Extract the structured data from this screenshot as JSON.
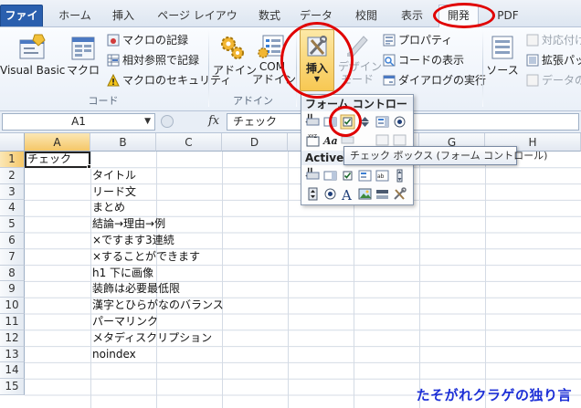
{
  "tabs": [
    {
      "label": "ファイル",
      "style": "file"
    },
    {
      "label": "ホーム"
    },
    {
      "label": "挿入"
    },
    {
      "label": "ページ レイアウト"
    },
    {
      "label": "数式"
    },
    {
      "label": "データ"
    },
    {
      "label": "校閲"
    },
    {
      "label": "表示"
    },
    {
      "label": "開発",
      "active": true
    },
    {
      "label": "PDF"
    }
  ],
  "ribbon": {
    "code": {
      "visual_basic": "Visual Basic",
      "macro": "マクロ",
      "record_macro": "マクロの記録",
      "relative_ref": "相対参照で記録",
      "macro_security": "マクロのセキュリティ",
      "group_label": "コード"
    },
    "addins": {
      "addin": "アドイン",
      "com_line1": "COM",
      "com_line2": "アドイン",
      "group_label": "アドイン"
    },
    "controls": {
      "insert": "挿入",
      "design_line1": "デザイン",
      "design_line2": "モード",
      "properties": "プロパティ",
      "view_code": "コードの表示",
      "run_dialog": "ダイアログの実行"
    },
    "xml": {
      "source": "ソース",
      "map_props": "対応付け",
      "expansion_packs": "拡張パッ",
      "refresh_data": "データの"
    }
  },
  "formula_bar": {
    "name_box": "A1",
    "fx": "fx",
    "content": "チェック"
  },
  "columns": [
    "A",
    "B",
    "C",
    "D",
    "E",
    "F",
    "G",
    "H"
  ],
  "selected_column": "A",
  "rows": [
    {
      "num": "1",
      "a": "チェック",
      "b": ""
    },
    {
      "num": "2",
      "a": "",
      "b": "タイトル"
    },
    {
      "num": "3",
      "a": "",
      "b": "リード文"
    },
    {
      "num": "4",
      "a": "",
      "b": "まとめ"
    },
    {
      "num": "5",
      "a": "",
      "b": "結論→理由→例"
    },
    {
      "num": "6",
      "a": "",
      "b": "×ですます3連続"
    },
    {
      "num": "7",
      "a": "",
      "b": "×することができます"
    },
    {
      "num": "8",
      "a": "",
      "b": "h1 下に画像"
    },
    {
      "num": "9",
      "a": "",
      "b": "装飾は必要最低限"
    },
    {
      "num": "10",
      "a": "",
      "b": "漢字とひらがなのバランス"
    },
    {
      "num": "11",
      "a": "",
      "b": "パーマリンク"
    },
    {
      "num": "12",
      "a": "",
      "b": "メタディスクリプション"
    },
    {
      "num": "13",
      "a": "",
      "b": "noindex"
    },
    {
      "num": "14",
      "a": "",
      "b": ""
    },
    {
      "num": "15",
      "a": "",
      "b": ""
    }
  ],
  "selected_row": "1",
  "dropdown": {
    "form_controls": "フォーム コントロール",
    "activex_controls": "ActiveX コントロール"
  },
  "tooltip": "チェック ボックス (フォーム コントロール)",
  "watermark": "たそがれクラゲの独り言",
  "colors": {
    "annotation_red": "#e00000",
    "file_tab": "#2a5fae",
    "selection_header": "#f5c768",
    "watermark_blue": "#1c2fd6"
  }
}
